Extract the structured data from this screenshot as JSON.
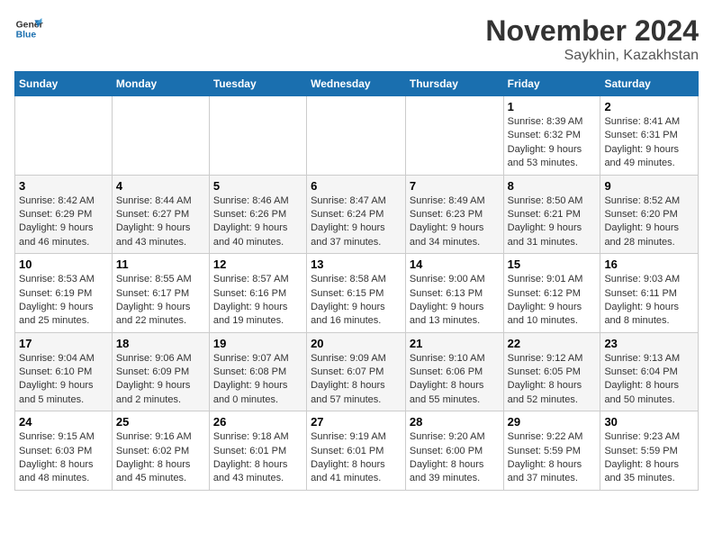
{
  "header": {
    "logo_general": "General",
    "logo_blue": "Blue",
    "month_title": "November 2024",
    "location": "Saykhin, Kazakhstan"
  },
  "days_of_week": [
    "Sunday",
    "Monday",
    "Tuesday",
    "Wednesday",
    "Thursday",
    "Friday",
    "Saturday"
  ],
  "weeks": [
    [
      {
        "day": "",
        "info": ""
      },
      {
        "day": "",
        "info": ""
      },
      {
        "day": "",
        "info": ""
      },
      {
        "day": "",
        "info": ""
      },
      {
        "day": "",
        "info": ""
      },
      {
        "day": "1",
        "info": "Sunrise: 8:39 AM\nSunset: 6:32 PM\nDaylight: 9 hours and 53 minutes."
      },
      {
        "day": "2",
        "info": "Sunrise: 8:41 AM\nSunset: 6:31 PM\nDaylight: 9 hours and 49 minutes."
      }
    ],
    [
      {
        "day": "3",
        "info": "Sunrise: 8:42 AM\nSunset: 6:29 PM\nDaylight: 9 hours and 46 minutes."
      },
      {
        "day": "4",
        "info": "Sunrise: 8:44 AM\nSunset: 6:27 PM\nDaylight: 9 hours and 43 minutes."
      },
      {
        "day": "5",
        "info": "Sunrise: 8:46 AM\nSunset: 6:26 PM\nDaylight: 9 hours and 40 minutes."
      },
      {
        "day": "6",
        "info": "Sunrise: 8:47 AM\nSunset: 6:24 PM\nDaylight: 9 hours and 37 minutes."
      },
      {
        "day": "7",
        "info": "Sunrise: 8:49 AM\nSunset: 6:23 PM\nDaylight: 9 hours and 34 minutes."
      },
      {
        "day": "8",
        "info": "Sunrise: 8:50 AM\nSunset: 6:21 PM\nDaylight: 9 hours and 31 minutes."
      },
      {
        "day": "9",
        "info": "Sunrise: 8:52 AM\nSunset: 6:20 PM\nDaylight: 9 hours and 28 minutes."
      }
    ],
    [
      {
        "day": "10",
        "info": "Sunrise: 8:53 AM\nSunset: 6:19 PM\nDaylight: 9 hours and 25 minutes."
      },
      {
        "day": "11",
        "info": "Sunrise: 8:55 AM\nSunset: 6:17 PM\nDaylight: 9 hours and 22 minutes."
      },
      {
        "day": "12",
        "info": "Sunrise: 8:57 AM\nSunset: 6:16 PM\nDaylight: 9 hours and 19 minutes."
      },
      {
        "day": "13",
        "info": "Sunrise: 8:58 AM\nSunset: 6:15 PM\nDaylight: 9 hours and 16 minutes."
      },
      {
        "day": "14",
        "info": "Sunrise: 9:00 AM\nSunset: 6:13 PM\nDaylight: 9 hours and 13 minutes."
      },
      {
        "day": "15",
        "info": "Sunrise: 9:01 AM\nSunset: 6:12 PM\nDaylight: 9 hours and 10 minutes."
      },
      {
        "day": "16",
        "info": "Sunrise: 9:03 AM\nSunset: 6:11 PM\nDaylight: 9 hours and 8 minutes."
      }
    ],
    [
      {
        "day": "17",
        "info": "Sunrise: 9:04 AM\nSunset: 6:10 PM\nDaylight: 9 hours and 5 minutes."
      },
      {
        "day": "18",
        "info": "Sunrise: 9:06 AM\nSunset: 6:09 PM\nDaylight: 9 hours and 2 minutes."
      },
      {
        "day": "19",
        "info": "Sunrise: 9:07 AM\nSunset: 6:08 PM\nDaylight: 9 hours and 0 minutes."
      },
      {
        "day": "20",
        "info": "Sunrise: 9:09 AM\nSunset: 6:07 PM\nDaylight: 8 hours and 57 minutes."
      },
      {
        "day": "21",
        "info": "Sunrise: 9:10 AM\nSunset: 6:06 PM\nDaylight: 8 hours and 55 minutes."
      },
      {
        "day": "22",
        "info": "Sunrise: 9:12 AM\nSunset: 6:05 PM\nDaylight: 8 hours and 52 minutes."
      },
      {
        "day": "23",
        "info": "Sunrise: 9:13 AM\nSunset: 6:04 PM\nDaylight: 8 hours and 50 minutes."
      }
    ],
    [
      {
        "day": "24",
        "info": "Sunrise: 9:15 AM\nSunset: 6:03 PM\nDaylight: 8 hours and 48 minutes."
      },
      {
        "day": "25",
        "info": "Sunrise: 9:16 AM\nSunset: 6:02 PM\nDaylight: 8 hours and 45 minutes."
      },
      {
        "day": "26",
        "info": "Sunrise: 9:18 AM\nSunset: 6:01 PM\nDaylight: 8 hours and 43 minutes."
      },
      {
        "day": "27",
        "info": "Sunrise: 9:19 AM\nSunset: 6:01 PM\nDaylight: 8 hours and 41 minutes."
      },
      {
        "day": "28",
        "info": "Sunrise: 9:20 AM\nSunset: 6:00 PM\nDaylight: 8 hours and 39 minutes."
      },
      {
        "day": "29",
        "info": "Sunrise: 9:22 AM\nSunset: 5:59 PM\nDaylight: 8 hours and 37 minutes."
      },
      {
        "day": "30",
        "info": "Sunrise: 9:23 AM\nSunset: 5:59 PM\nDaylight: 8 hours and 35 minutes."
      }
    ]
  ]
}
